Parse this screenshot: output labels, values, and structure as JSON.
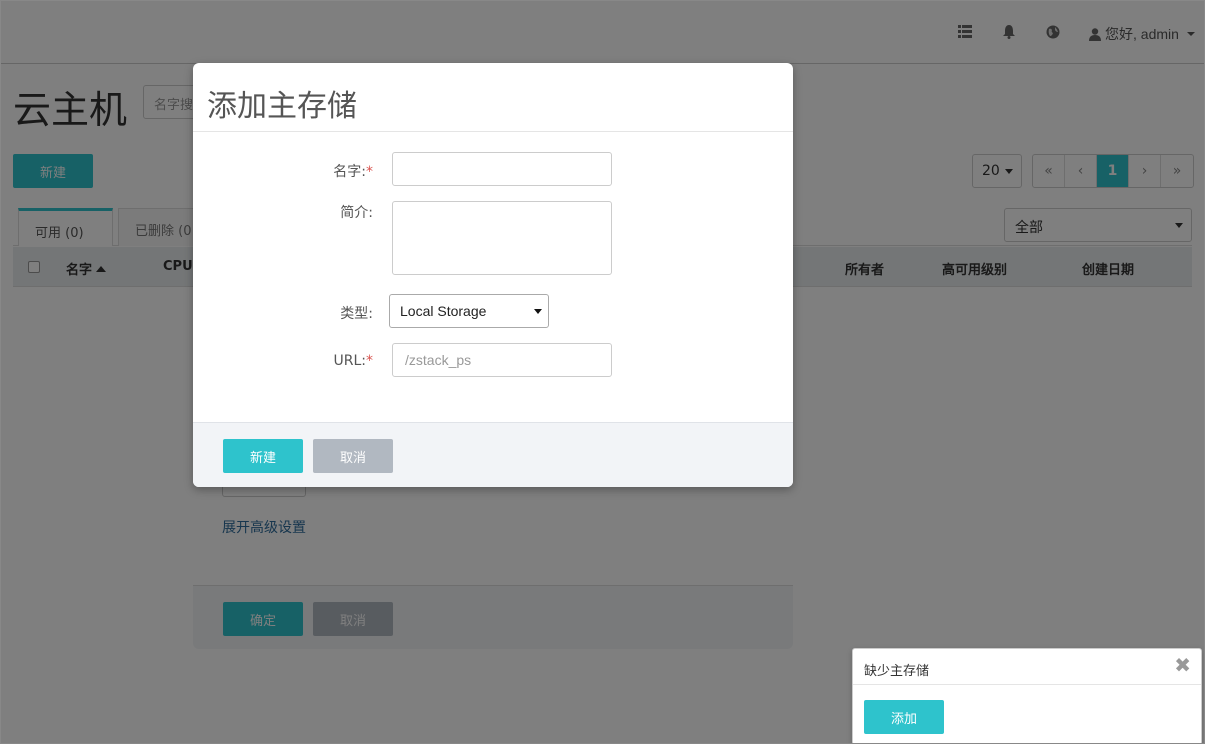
{
  "navbar": {
    "icons": [
      "list-icon",
      "bell-icon",
      "globe-icon",
      "user-icon"
    ],
    "user_label": "您好, admin"
  },
  "page": {
    "title": "云主机",
    "search_placeholder": "名字搜",
    "new_button": "新建",
    "tabs": [
      {
        "label": "可用 (0)"
      },
      {
        "label": "已删除 (0"
      }
    ],
    "page_size": "20",
    "pager": [
      "«",
      "‹",
      "1",
      "›",
      "»"
    ],
    "filter_value": "全部",
    "table_headers": {
      "name": "名字",
      "cpu": "CPU",
      "owner": "所有者",
      "ha_level": "高可用级别",
      "created": "创建日期"
    }
  },
  "background_dialog": {
    "advanced_link": "展开高级设置",
    "confirm_button": "确定",
    "cancel_button": "取消"
  },
  "modal": {
    "title": "添加主存储",
    "fields": {
      "name_label": "名字:",
      "desc_label": "简介:",
      "type_label": "类型:",
      "type_value": "Local Storage",
      "url_label": "URL:",
      "url_placeholder": "/zstack_ps"
    },
    "new_button": "新建",
    "cancel_button": "取消"
  },
  "notification": {
    "message": "缺少主存储",
    "add_button": "添加"
  },
  "colors": {
    "accent": "#2ec3cc",
    "cancel_gray": "#b1b8c1",
    "required": "#d9534f"
  }
}
